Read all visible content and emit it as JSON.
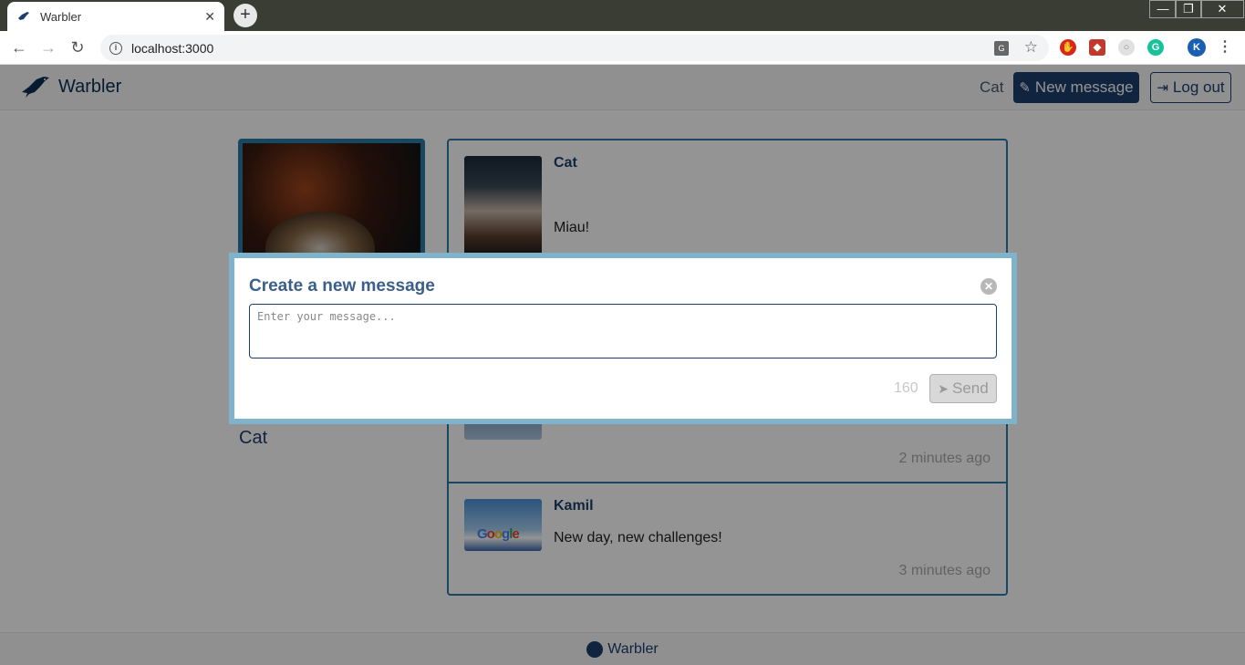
{
  "browser": {
    "tab_title": "Warbler",
    "tab_close": "✕",
    "new_tab": "+",
    "url": "localhost:3000",
    "back": "←",
    "forward": "→",
    "reload": "↻",
    "profile_initial": "K",
    "more": "⋮",
    "window_min": "—",
    "window_max": "❐",
    "window_close": "✕"
  },
  "navbar": {
    "brand": "Warbler",
    "user": "Cat",
    "new_message": "New message",
    "logout": "Log out"
  },
  "profile": {
    "name": "Cat"
  },
  "messages": [
    {
      "author": "Cat",
      "text": "Miau!",
      "time": ""
    },
    {
      "author": "",
      "text": "",
      "time": "2 minutes ago"
    },
    {
      "author": "Kamil",
      "text": "New day, new challenges!",
      "time": "3 minutes ago"
    }
  ],
  "footer": {
    "link": "Warbler"
  },
  "modal": {
    "title": "Create a new message",
    "placeholder": "Enter your message...",
    "value": "",
    "char_count": "160",
    "send_label": "Send",
    "close": "✕"
  },
  "colors": {
    "primary": "#1d3f6e",
    "accent_border": "#2a7aa8",
    "modal_border": "#7fb3cc",
    "backdrop": "rgba(0,0,0,0.42)"
  }
}
